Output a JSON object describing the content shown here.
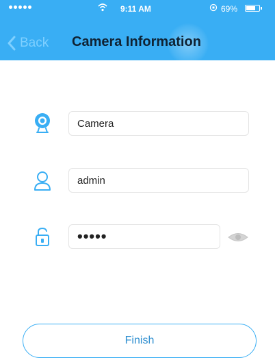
{
  "status_bar": {
    "time": "9:11 AM",
    "battery_text": "69%",
    "battery_level": 0.69,
    "icons": [
      "signal-dots-icon",
      "wifi-icon",
      "orientation-lock-icon",
      "battery-icon"
    ]
  },
  "nav": {
    "back_label": "Back",
    "title": "Camera Information"
  },
  "form": {
    "camera_name": "Camera",
    "username": "admin",
    "password_masked": "•••••",
    "icons": [
      "camera-icon",
      "user-icon",
      "lock-icon",
      "eye-icon"
    ]
  },
  "actions": {
    "finish_label": "Finish"
  },
  "colors": {
    "header_bg": "#39aef4",
    "accent": "#2f8fd0",
    "title_text": "#0f2233"
  }
}
